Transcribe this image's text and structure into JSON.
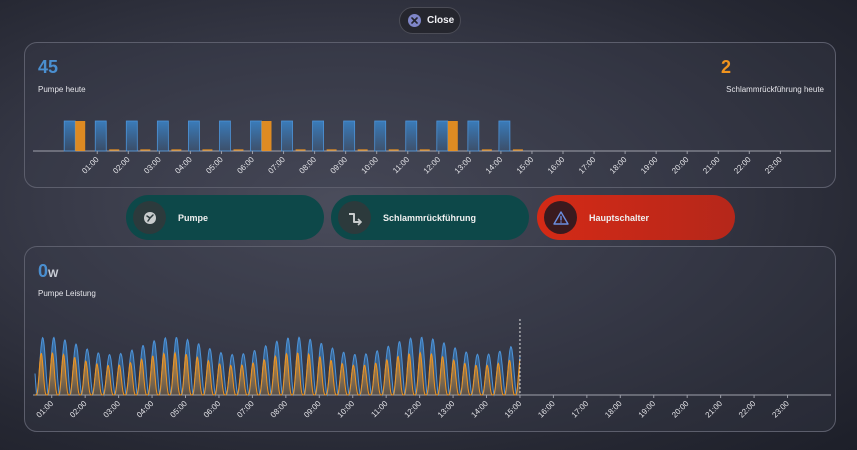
{
  "close_button": {
    "label": "Close"
  },
  "pump_card": {
    "left": {
      "value": "45",
      "label": "Pumpe heute"
    },
    "right": {
      "value": "2",
      "label": "Schlammrückführung heute"
    }
  },
  "tiles": [
    {
      "label": "Pumpe",
      "icon": "pump-icon"
    },
    {
      "label": "Schlammrückführung",
      "icon": "valve-icon"
    },
    {
      "label": "Hauptschalter",
      "icon": "warning-icon"
    }
  ],
  "power_card": {
    "value": "0",
    "unit": "W",
    "label": "Pumpe Leistung"
  },
  "colors": {
    "blue": "#3a7fc0",
    "orange": "#f0941e",
    "teal": "#0d4849",
    "red": "#d42a16"
  },
  "chart_data": [
    {
      "type": "bar",
      "x_ticks": [
        "01:00",
        "02:00",
        "03:00",
        "04:00",
        "05:00",
        "06:00",
        "07:00",
        "08:00",
        "09:00",
        "10:00",
        "11:00",
        "12:00",
        "13:00",
        "14:00",
        "15:00",
        "16:00",
        "17:00",
        "18:00",
        "19:00",
        "20:00",
        "21:00",
        "22:00",
        "23:00"
      ],
      "series": [
        {
          "color": "#3a7fc0",
          "on_hours": [
            0,
            1,
            2,
            3,
            4,
            5,
            6,
            7,
            8,
            9,
            10,
            11,
            12,
            13,
            14
          ],
          "values": [
            1,
            1,
            1,
            1,
            1,
            1,
            1,
            1,
            1,
            1,
            1,
            1,
            1,
            1,
            1
          ]
        },
        {
          "color": "#f0941e",
          "on_hours": [
            0,
            6,
            12
          ],
          "values": [
            1,
            1,
            1
          ]
        }
      ]
    },
    {
      "type": "area",
      "x_ticks": [
        "01:00",
        "02:00",
        "03:00",
        "04:00",
        "05:00",
        "06:00",
        "07:00",
        "08:00",
        "09:00",
        "10:00",
        "11:00",
        "12:00",
        "13:00",
        "14:00",
        "15:00",
        "16:00",
        "17:00",
        "18:00",
        "19:00",
        "20:00",
        "21:00",
        "22:00",
        "23:00"
      ],
      "x_range": [
        0.5,
        24.3
      ],
      "data_end": 15.0,
      "cycles_per_hour": 3,
      "series": [
        {
          "color": "#3a7fc0",
          "peak": 0.85
        },
        {
          "color": "#f0941e",
          "peak": 0.62
        }
      ]
    }
  ]
}
